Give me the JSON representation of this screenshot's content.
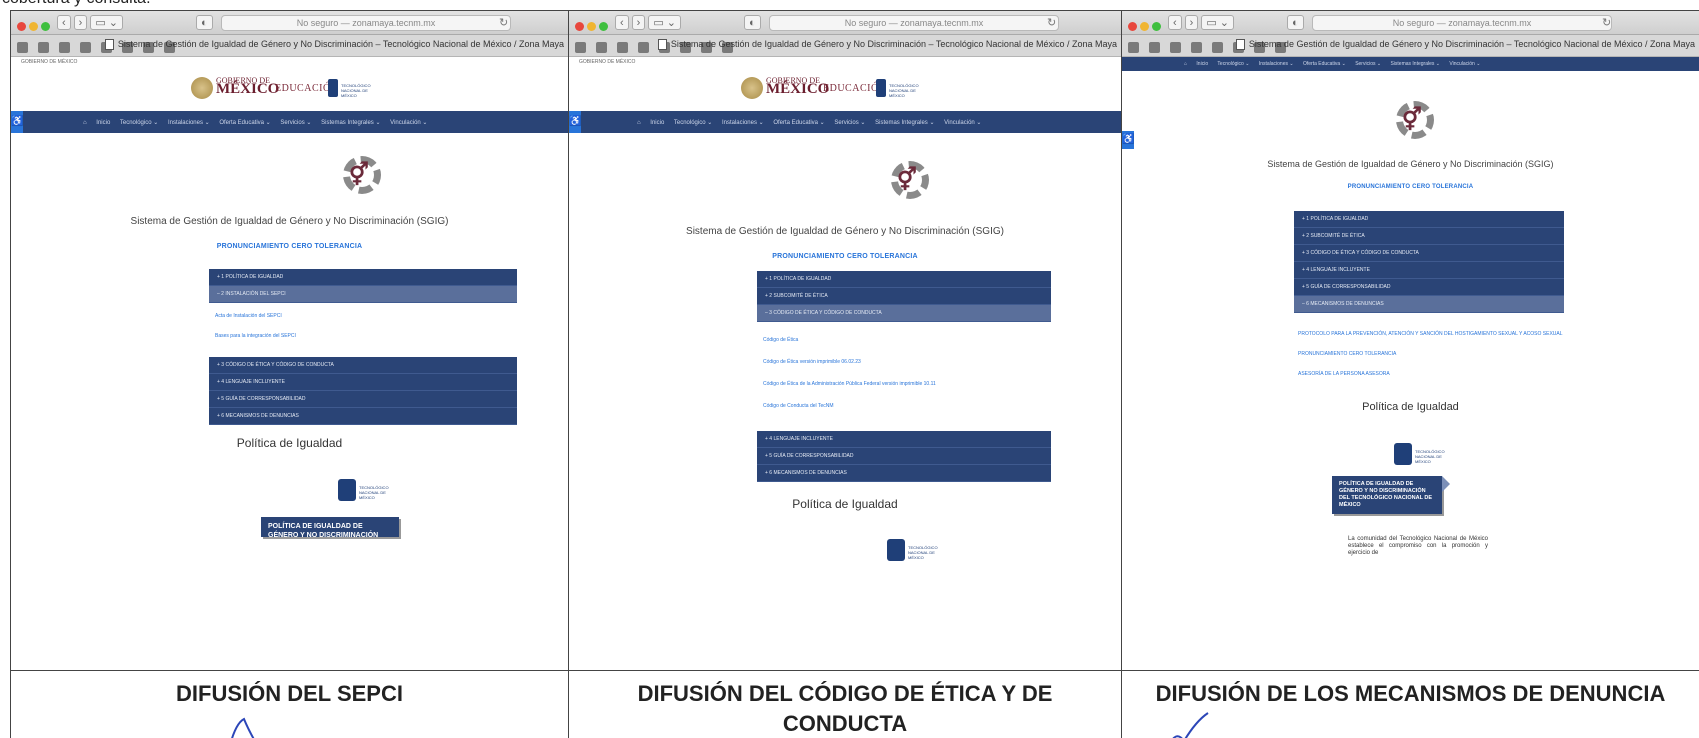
{
  "top_text": "cobertura y consulta.",
  "browser": {
    "url_text_1": "No seguro — zonamaya.tecnm.mx",
    "url_text_2": "No seguro — zonamaya.tecnm.mx",
    "url_text_3": "No seguro — zonamaya.tecnm.mx",
    "tab_title": "Sistema de Gestión de Igualdad de Género y No Discriminación – Tecnológico Nacional de México / Zona Maya"
  },
  "site": {
    "gov_strip": "GOBIERNO DE MÉXICO",
    "gob_small": "GOBIERNO DE",
    "gob_big": "MÉXICO",
    "educacion": "EDUCACIÓN",
    "tec_logo_text": "TECNOLÓGICO NACIONAL DE MÉXICO",
    "nav_items": [
      "Inicio",
      "Tecnológico ⌄",
      "Instalaciones ⌄",
      "Oferta Educativa ⌄",
      "Servicios ⌄",
      "Sistemas Integrales ⌄",
      "Vinculación ⌄"
    ],
    "sgig_title": "Sistema de Gestión de Igualdad de Género y No Discriminación (SGIG)",
    "pronunciamiento": "PRONUNCIAMIENTO CERO TOLERANCIA",
    "politica_igualdad": "Política de Igualdad"
  },
  "panel1": {
    "accordion_top": [
      "+ 1 POLÍTICA DE IGUALDAD",
      "– 2 INSTALACIÓN DEL SEPCI"
    ],
    "links": [
      "Acta de Instalación del SEPCI",
      "Bases para la integración del SEPCI"
    ],
    "accordion_bottom": [
      "+ 3 CÓDIGO DE ÉTICA Y CÓDIGO DE CONDUCTA",
      "+ 4 LENGUAJE INCLUYENTE",
      "+ 5 GUÍA DE CORRESPONSABILIDAD",
      "+ 6 MECANISMOS DE DENUNCIAS"
    ],
    "banner": "POLÍTICA DE IGUALDAD DE GÉNERO Y NO DISCRIMINACIÓN"
  },
  "panel2": {
    "accordion_top": [
      "+ 1 POLÍTICA DE IGUALDAD",
      "+ 2 SUBCOMITÉ DE ÉTICA",
      "– 3 CÓDIGO DE ÉTICA Y CÓDIGO DE CONDUCTA"
    ],
    "links": [
      "Código de Ética",
      "Código de Ética versión imprimible 06.02.23",
      "Código de Ética de la Administración Pública Federal versión imprimible 10.11",
      "Código de Conducta del TecNM"
    ],
    "accordion_bottom": [
      "+ 4 LENGUAJE INCLUYENTE",
      "+ 5 GUÍA DE CORRESPONSABILIDAD",
      "+ 6 MECANISMOS DE DENUNCIAS"
    ]
  },
  "panel3": {
    "accordion_top": [
      "+ 1 POLÍTICA DE IGUALDAD",
      "+ 2 SUBCOMITÉ DE ÉTICA",
      "+ 3 CÓDIGO DE ÉTICA Y CÓDIGO DE CONDUCTA",
      "+ 4 LENGUAJE INCLUYENTE",
      "+ 5 GUÍA DE CORRESPONSABILIDAD",
      "– 6 MECANISMOS DE DENUNCIAS"
    ],
    "links": [
      "PROTOCOLO PARA LA PREVENCIÓN, ATENCIÓN Y SANCIÓN DEL HOSTIGAMIENTO SEXUAL Y ACOSO SEXUAL",
      "PRONUNCIAMIENTO CERO TOLERANCIA",
      "ASESORÍA DE LA PERSONA ASESORA"
    ],
    "banner": "POLÍTICA DE IGUALDAD DE GÉNERO Y NO DISCRIMINACIÓN DEL TECNOLÓGICO NACIONAL DE MÉXICO",
    "paragraph": "La comunidad del Tecnológico Nacional de México establece el compromiso con la promoción y ejercicio de"
  },
  "captions": [
    "DIFUSIÓN DEL SEPCI",
    "DIFUSIÓN DEL CÓDIGO DE ÉTICA Y DE CONDUCTA",
    "DIFUSIÓN DE LOS MECANISMOS DE DENUNCIA"
  ],
  "colors": {
    "navbar": "#2a4476",
    "link": "#2874d9",
    "accordion_open": "#5a6f9b",
    "gob_red": "#6b1e2e"
  }
}
